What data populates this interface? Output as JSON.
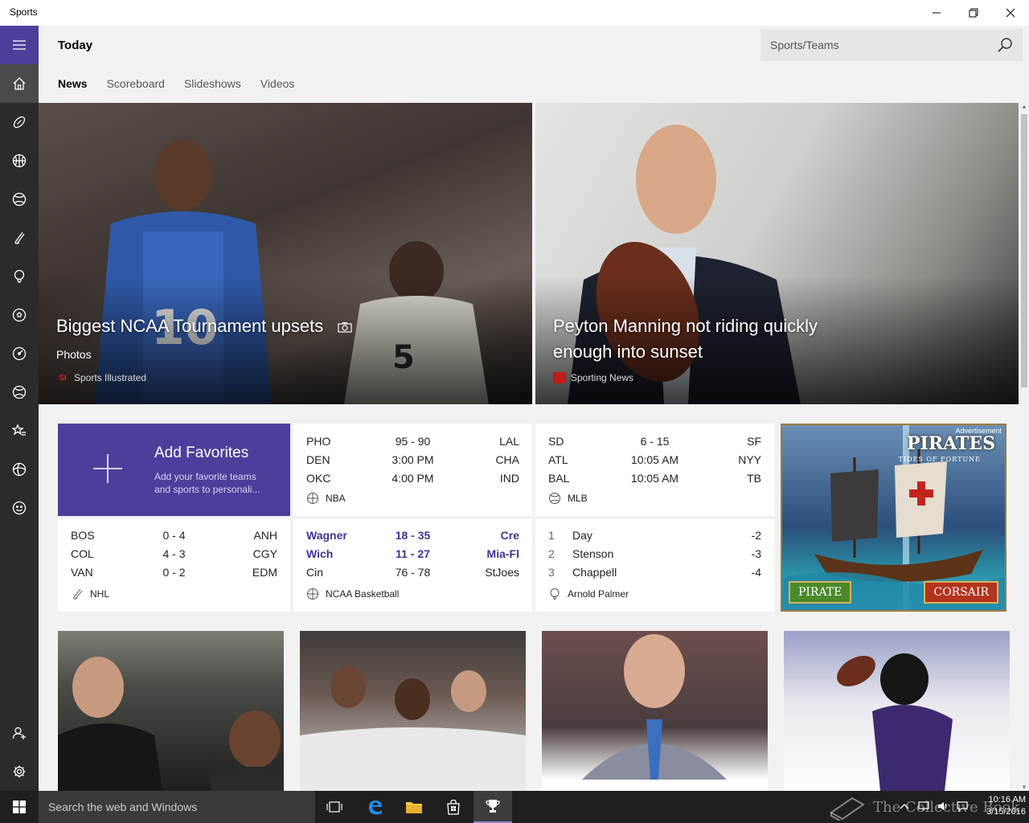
{
  "window": {
    "title": "Sports"
  },
  "header": {
    "page_title": "Today",
    "search_placeholder": "Sports/Teams",
    "tabs": [
      {
        "label": "News",
        "active": true
      },
      {
        "label": "Scoreboard",
        "active": false
      },
      {
        "label": "Slideshows",
        "active": false
      },
      {
        "label": "Videos",
        "active": false
      }
    ]
  },
  "rail": {
    "items": [
      {
        "icon": "hamburger-menu-icon"
      },
      {
        "icon": "home-icon"
      },
      {
        "icon": "football-icon"
      },
      {
        "icon": "basketball-icon"
      },
      {
        "icon": "baseball-icon"
      },
      {
        "icon": "hockey-icon"
      },
      {
        "icon": "golf-icon"
      },
      {
        "icon": "soccer-icon"
      },
      {
        "icon": "racing-icon"
      },
      {
        "icon": "tennis-icon"
      },
      {
        "icon": "favorites-icon"
      },
      {
        "icon": "all-sports-icon"
      },
      {
        "icon": "fantasy-icon"
      },
      {
        "icon": "account-icon"
      },
      {
        "icon": "settings-icon"
      }
    ]
  },
  "hero": [
    {
      "headline": "Biggest NCAA Tournament upsets",
      "label": "Photos",
      "source": "Sports Illustrated",
      "source_logo": "SI"
    },
    {
      "headline_line1": "Peyton Manning not riding quickly",
      "headline_line2": "enough into sunset",
      "source": "Sporting News"
    }
  ],
  "add_favorites": {
    "title": "Add Favorites",
    "subtitle_line1": "Add your favorite teams",
    "subtitle_line2": "and sports to personali..."
  },
  "scores": {
    "nba": {
      "league": "NBA",
      "rows": [
        {
          "a": "PHO",
          "s": "95  -  90",
          "b": "LAL"
        },
        {
          "a": "DEN",
          "s": "3:00 PM",
          "b": "CHA"
        },
        {
          "a": "OKC",
          "s": "4:00 PM",
          "b": "IND"
        }
      ]
    },
    "mlb": {
      "league": "MLB",
      "rows": [
        {
          "a": "SD",
          "s": "6  -  15",
          "b": "SF"
        },
        {
          "a": "ATL",
          "s": "10:05 AM",
          "b": "NYY"
        },
        {
          "a": "BAL",
          "s": "10:05 AM",
          "b": "TB"
        }
      ]
    },
    "nhl": {
      "league": "NHL",
      "rows": [
        {
          "a": "BOS",
          "s": "0  -  4",
          "b": "ANH"
        },
        {
          "a": "COL",
          "s": "4  -  3",
          "b": "CGY"
        },
        {
          "a": "VAN",
          "s": "0  -  2",
          "b": "EDM"
        }
      ]
    },
    "ncaa": {
      "league": "NCAA Basketball",
      "rows": [
        {
          "a": "Wagner",
          "s": "18  -  35",
          "b": "Cre"
        },
        {
          "a": "Wich",
          "s": "11  -  27",
          "b": "Mia-Fl"
        },
        {
          "a": "Cin",
          "s": "76  -  78",
          "b": "StJoes"
        }
      ]
    },
    "golf": {
      "league": "Arnold Palmer",
      "rows": [
        {
          "pos": "1",
          "name": "Day",
          "score": "-2"
        },
        {
          "pos": "2",
          "name": "Stenson",
          "score": "-3"
        },
        {
          "pos": "3",
          "name": "Chappell",
          "score": "-4"
        }
      ]
    }
  },
  "ad": {
    "label": "Advertisement",
    "brand": "PIRATES",
    "tagline": "TIDES OF FORTUNE",
    "left_button": "PIRATE",
    "right_button": "CORSAIR"
  },
  "taskbar": {
    "search_placeholder": "Search the web and Windows",
    "watermark": "The Collective Book",
    "time": "10:16 AM",
    "date": "3/15/2016"
  },
  "colors": {
    "accent": "#4c3f9b",
    "rail": "#2b2b2b",
    "winning_team": "#3e3494"
  }
}
